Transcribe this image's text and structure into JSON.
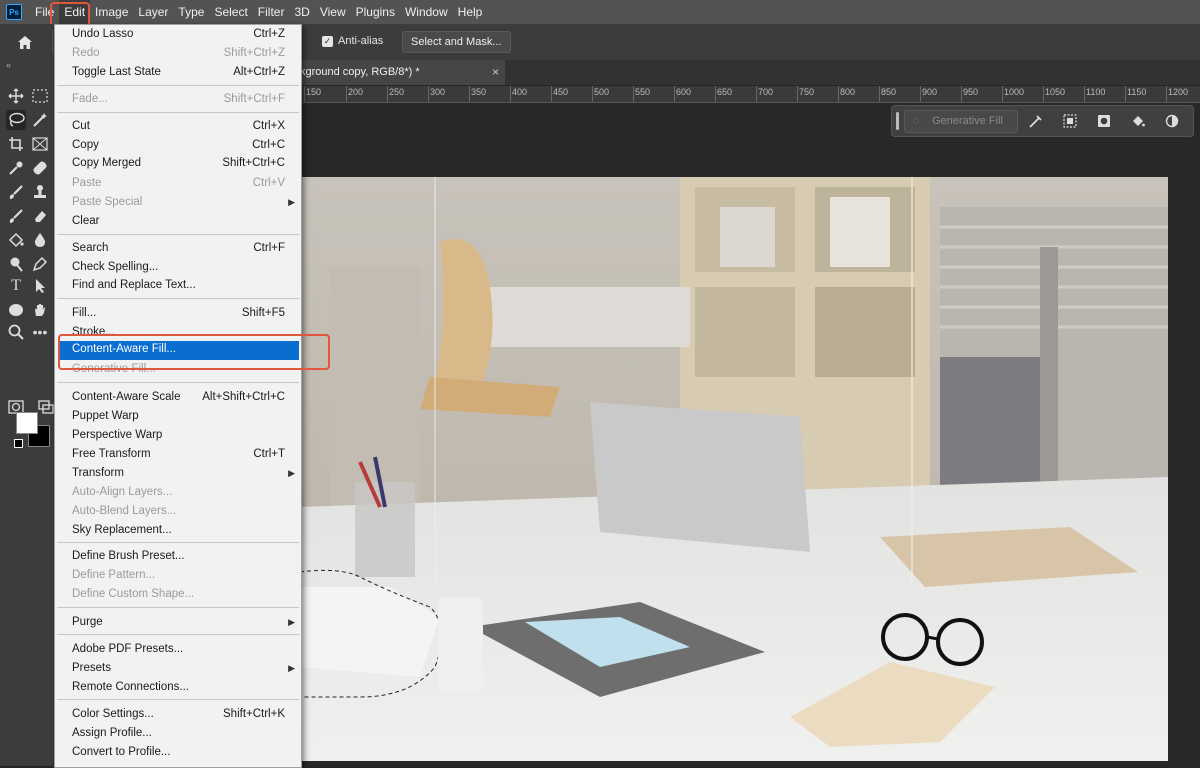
{
  "menubar": {
    "items": [
      "File",
      "Edit",
      "Image",
      "Layer",
      "Type",
      "Select",
      "Filter",
      "3D",
      "View",
      "Plugins",
      "Window",
      "Help"
    ],
    "active": "Edit"
  },
  "options": {
    "anti_alias": "Anti-alias",
    "select_and_mask": "Select and Mask..."
  },
  "document": {
    "tab_title": "kground copy, RGB/8*) *",
    "close": "×",
    "ruler": [
      "150",
      "200",
      "250",
      "300",
      "350",
      "400",
      "450",
      "500",
      "550",
      "600",
      "650",
      "700",
      "750",
      "800",
      "850",
      "900",
      "950",
      "1000",
      "1050",
      "1100",
      "1150",
      "1200"
    ]
  },
  "taskbar": {
    "generative_fill": "Generative Fill"
  },
  "edit_menu": {
    "items": [
      {
        "label": "Undo Lasso",
        "shortcut": "Ctrl+Z",
        "state": "enabled"
      },
      {
        "label": "Redo",
        "shortcut": "Shift+Ctrl+Z",
        "state": "disabled"
      },
      {
        "label": "Toggle Last State",
        "shortcut": "Alt+Ctrl+Z",
        "state": "enabled"
      },
      {
        "label": "Fade...",
        "shortcut": "Shift+Ctrl+F",
        "state": "disabled"
      },
      {
        "label": "Cut",
        "shortcut": "Ctrl+X",
        "state": "enabled"
      },
      {
        "label": "Copy",
        "shortcut": "Ctrl+C",
        "state": "enabled"
      },
      {
        "label": "Copy Merged",
        "shortcut": "Shift+Ctrl+C",
        "state": "enabled"
      },
      {
        "label": "Paste",
        "shortcut": "Ctrl+V",
        "state": "disabled"
      },
      {
        "label": "Paste Special",
        "shortcut": "",
        "state": "disabled",
        "submenu": true
      },
      {
        "label": "Clear",
        "shortcut": "",
        "state": "enabled"
      },
      {
        "label": "Search",
        "shortcut": "Ctrl+F",
        "state": "enabled"
      },
      {
        "label": "Check Spelling...",
        "shortcut": "",
        "state": "enabled"
      },
      {
        "label": "Find and Replace Text...",
        "shortcut": "",
        "state": "enabled"
      },
      {
        "label": "Fill...",
        "shortcut": "Shift+F5",
        "state": "enabled"
      },
      {
        "label": "Stroke...",
        "shortcut": "",
        "state": "enabled"
      },
      {
        "label": "Content-Aware Fill...",
        "shortcut": "",
        "state": "highlighted"
      },
      {
        "label": "Generative Fill...",
        "shortcut": "",
        "state": "disabled"
      },
      {
        "label": "Content-Aware Scale",
        "shortcut": "Alt+Shift+Ctrl+C",
        "state": "enabled"
      },
      {
        "label": "Puppet Warp",
        "shortcut": "",
        "state": "enabled"
      },
      {
        "label": "Perspective Warp",
        "shortcut": "",
        "state": "enabled"
      },
      {
        "label": "Free Transform",
        "shortcut": "Ctrl+T",
        "state": "enabled"
      },
      {
        "label": "Transform",
        "shortcut": "",
        "state": "enabled",
        "submenu": true
      },
      {
        "label": "Auto-Align Layers...",
        "shortcut": "",
        "state": "disabled"
      },
      {
        "label": "Auto-Blend Layers...",
        "shortcut": "",
        "state": "disabled"
      },
      {
        "label": "Sky Replacement...",
        "shortcut": "",
        "state": "enabled"
      },
      {
        "label": "Define Brush Preset...",
        "shortcut": "",
        "state": "enabled"
      },
      {
        "label": "Define Pattern...",
        "shortcut": "",
        "state": "disabled"
      },
      {
        "label": "Define Custom Shape...",
        "shortcut": "",
        "state": "disabled"
      },
      {
        "label": "Purge",
        "shortcut": "",
        "state": "enabled",
        "submenu": true
      },
      {
        "label": "Adobe PDF Presets...",
        "shortcut": "",
        "state": "enabled"
      },
      {
        "label": "Presets",
        "shortcut": "",
        "state": "enabled",
        "submenu": true
      },
      {
        "label": "Remote Connections...",
        "shortcut": "",
        "state": "enabled"
      },
      {
        "label": "Color Settings...",
        "shortcut": "Shift+Ctrl+K",
        "state": "enabled"
      },
      {
        "label": "Assign Profile...",
        "shortcut": "",
        "state": "enabled"
      },
      {
        "label": "Convert to Profile...",
        "shortcut": "",
        "state": "enabled"
      }
    ]
  },
  "colors": {
    "highlight": "#0a6ed1",
    "callout": "#e0573c",
    "app_bg": "#262626"
  }
}
